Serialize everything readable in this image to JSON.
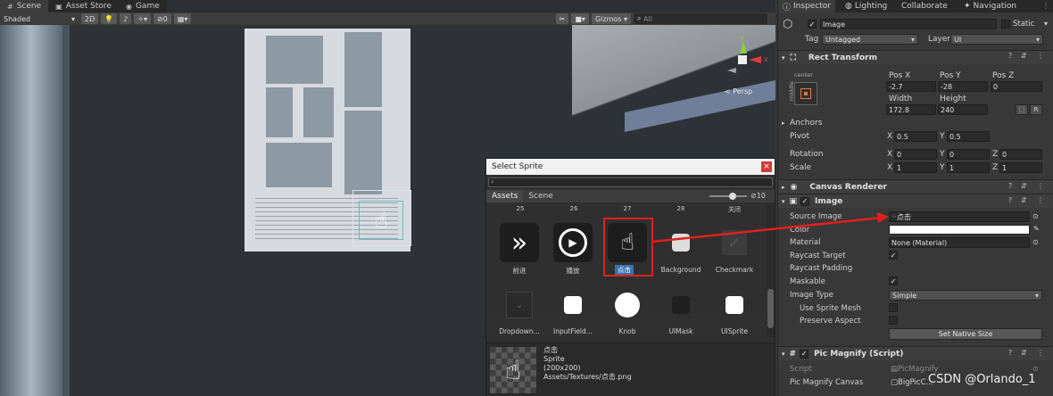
{
  "tabs": {
    "scene": "Scene",
    "asset_store": "Asset Store",
    "game": "Game",
    "inspector": "Inspector",
    "lighting": "Lighting",
    "collaborate": "Collaborate",
    "navigation": "Navigation"
  },
  "scene_toolbar": {
    "shading": "Shaded",
    "mode": "2D",
    "gizmos": "Gizmos",
    "search_placeholder": "All",
    "hidden_count": "0"
  },
  "gizmo": {
    "persp": "< Persp",
    "y": "y",
    "x": "x"
  },
  "picker": {
    "title": "Select Sprite",
    "tab_assets": "Assets",
    "tab_scene": "Scene",
    "count": "10",
    "row1_nums": [
      "25",
      "26",
      "27",
      "28",
      "关闭"
    ],
    "row1": [
      "前进",
      "播放",
      "点击",
      "Background",
      "Checkmark"
    ],
    "row2": [
      "Dropdown...",
      "InputField...",
      "Knob",
      "UIMask",
      "UISprite"
    ],
    "info_name": "点击",
    "info_type": "Sprite",
    "info_size": "(200x200)",
    "info_path": "Assets/Textures/点击.png"
  },
  "inspector": {
    "object_name": "Image",
    "static_label": "Static",
    "tag_label": "Tag",
    "tag_value": "Untagged",
    "layer_label": "Layer",
    "layer_value": "UI",
    "rect": {
      "title": "Rect Transform",
      "anchor_h": "center",
      "anchor_v": "middle",
      "posx_l": "Pos X",
      "posy_l": "Pos Y",
      "posz_l": "Pos Z",
      "posx": "-2.7",
      "posy": "-28",
      "posz": "0",
      "w_l": "Width",
      "h_l": "Height",
      "w": "172.8",
      "h": "240",
      "r_btn": "R",
      "anchors": "Anchors",
      "pivot": "Pivot",
      "pivot_x": "0.5",
      "pivot_y": "0.5",
      "rotation": "Rotation",
      "rot_x": "0",
      "rot_y": "0",
      "rot_z": "0",
      "scale": "Scale",
      "sc_x": "1",
      "sc_y": "1",
      "sc_z": "1",
      "x": "X",
      "y": "Y",
      "z": "Z"
    },
    "canvas_renderer": "Canvas Renderer",
    "image": {
      "title": "Image",
      "source_image_l": "Source Image",
      "source_image": "点击",
      "color_l": "Color",
      "material_l": "Material",
      "material": "None (Material)",
      "raycast_target": "Raycast Target",
      "raycast_padding": "Raycast Padding",
      "maskable": "Maskable",
      "image_type_l": "Image Type",
      "image_type": "Simple",
      "use_sprite_mesh": "Use Sprite Mesh",
      "preserve_aspect": "Preserve Aspect",
      "set_native": "Set Native Size"
    },
    "magnify": {
      "title": "Pic Magnify (Script)",
      "script_l": "Script",
      "script": "PicMagnify",
      "canvas_l": "Pic Magnify Canvas",
      "canvas": "BigPicC..."
    }
  },
  "watermark": "CSDN @Orlando_1",
  "colors": {
    "accent_red": "#e0201c",
    "selection": "#3a72b0",
    "panel": "#383838"
  }
}
